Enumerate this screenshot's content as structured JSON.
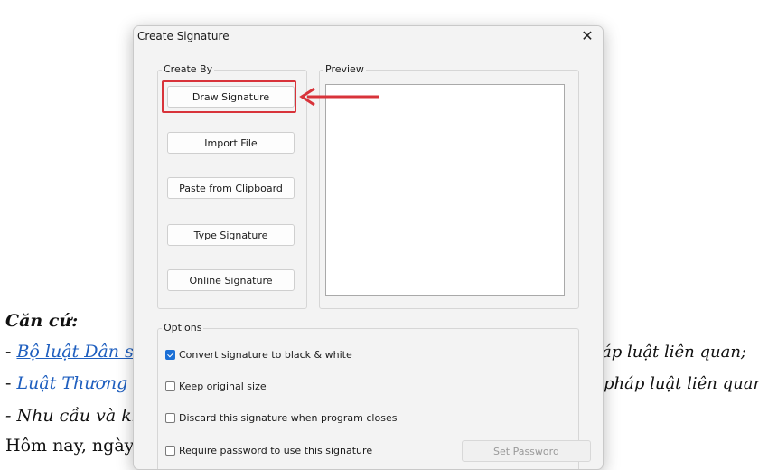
{
  "document": {
    "heading": "Căn cứ:",
    "line1_prefix": "- ",
    "line1_link": "Bộ luật Dân sự",
    "line1_tail": "áp luật liên quan;",
    "line2_prefix": "- ",
    "line2_link": "Luật Thương m",
    "line2_tail": "pháp luật liên quan",
    "line3": "- Nhu cầu và kh",
    "line4": "Hôm nay, ngày"
  },
  "dialog": {
    "title": "Create Signature",
    "close_glyph": "✕",
    "create_by": {
      "label": "Create By",
      "buttons": [
        "Draw Signature",
        "Import File",
        "Paste from Clipboard",
        "Type Signature",
        "Online Signature"
      ]
    },
    "preview": {
      "label": "Preview"
    },
    "options": {
      "label": "Options",
      "items": [
        {
          "label": "Convert signature to black & white",
          "checked": true
        },
        {
          "label": "Keep original size",
          "checked": false
        },
        {
          "label": "Discard this signature when program closes",
          "checked": false
        },
        {
          "label": "Require password to use this signature",
          "checked": false
        }
      ],
      "set_password_label": "Set Password"
    }
  },
  "annotation": {
    "highlight_color": "#d8333a"
  }
}
